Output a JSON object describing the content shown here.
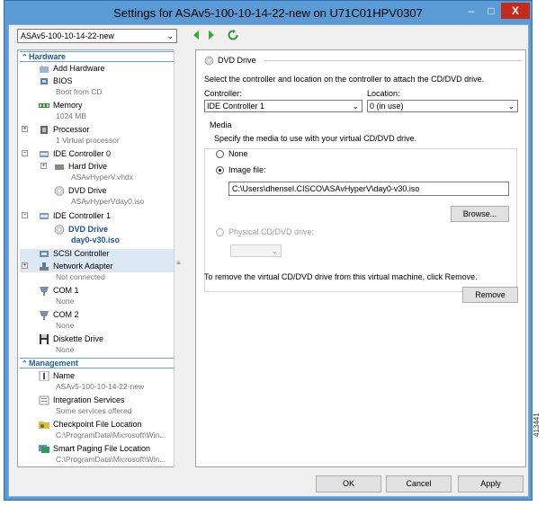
{
  "window": {
    "title": "Settings for ASAv5-100-10-14-22-new on U71C01HPV0307",
    "minimize": "–",
    "maximize": "□",
    "close": "X"
  },
  "vm_selector": {
    "value": "ASAv5-100-10-14-22-new"
  },
  "sidebar": {
    "hardware_header": "Hardware",
    "management_header": "Management",
    "items": {
      "add_hardware": "Add Hardware",
      "bios": "BIOS",
      "bios_sub": "Boot from CD",
      "memory": "Memory",
      "memory_sub": "1024 MB",
      "processor": "Processor",
      "processor_sub": "1 Virtual processor",
      "ide0": "IDE Controller 0",
      "hard_drive": "Hard Drive",
      "hard_drive_sub": "ASAvHyperV.vhdx",
      "dvd0": "DVD Drive",
      "dvd0_sub": "ASAvHyperVday0.iso",
      "ide1": "IDE Controller 1",
      "dvd1": "DVD Drive",
      "dvd1_sub": "day0-v30.iso",
      "scsi": "SCSI Controller",
      "network": "Network Adapter",
      "network_sub": "Not connected",
      "com1": "COM 1",
      "com1_sub": "None",
      "com2": "COM 2",
      "com2_sub": "None",
      "diskette": "Diskette Drive",
      "diskette_sub": "None",
      "name": "Name",
      "name_sub": "ASAv5-100-10-14-22-new",
      "integration": "Integration Services",
      "integration_sub": "Some services offered",
      "checkpoint": "Checkpoint File Location",
      "checkpoint_sub": "C:\\ProgramData\\Microsoft\\Win...",
      "paging": "Smart Paging File Location",
      "paging_sub": "C:\\ProgramData\\Microsoft\\Win..."
    }
  },
  "panel": {
    "title": "DVD Drive",
    "description": "Select the controller and location on the controller to attach the CD/DVD drive.",
    "controller_label": "Controller:",
    "controller_value": "IDE Controller 1",
    "location_label": "Location:",
    "location_value": "0 (in use)",
    "media_label": "Media",
    "media_description": "Specify the media to use with your virtual CD/DVD drive.",
    "none_label": "None",
    "image_label": "Image file:",
    "image_path": "C:\\Users\\dhensel.CISCO\\ASAvHyperV\\day0-v30.iso",
    "browse": "Browse...",
    "physical_label": "Physical CD/DVD drive:",
    "remove_description": "To remove the virtual CD/DVD drive from this virtual machine, click Remove.",
    "remove": "Remove"
  },
  "footer": {
    "ok": "OK",
    "cancel": "Cancel",
    "apply": "Apply"
  },
  "doc_id": "413441",
  "colors": {
    "titlebar": "#5b9bd5",
    "close": "#c42b1c",
    "section_text": "#1f5fa8",
    "selection": "#dde8f5"
  }
}
